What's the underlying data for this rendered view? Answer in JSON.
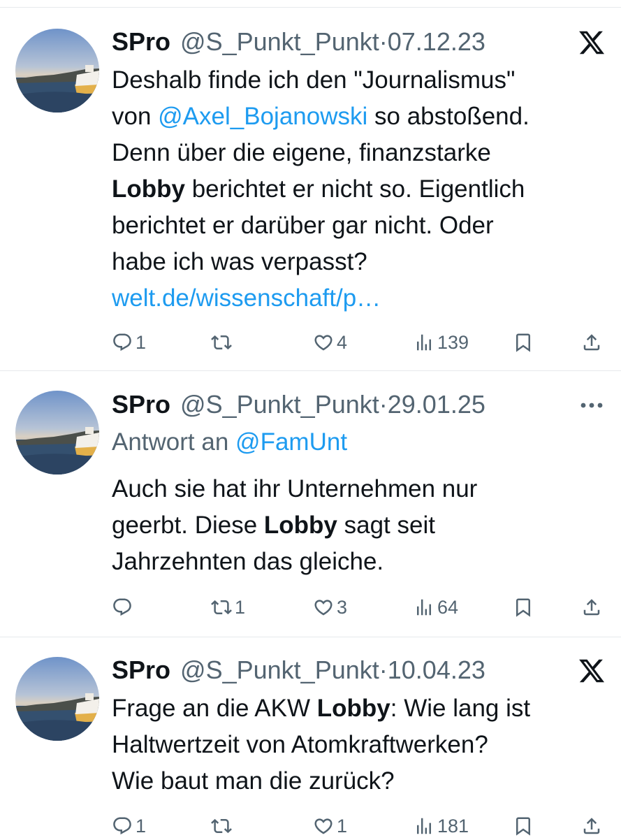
{
  "tweets": [
    {
      "name": "SPro",
      "handle": "@S_Punkt_Punkt",
      "date": "07.12.23",
      "corner_icon": "x-logo-icon",
      "text_a": "Deshalb finde ich den \"Journalismus\"",
      "text_b1": "von ",
      "mention": "@Axel_Bojanowski",
      "text_b2": " so abstoßend.",
      "text_c": "Denn über die eigene, finanzstarke",
      "bold1": "Lobby",
      "text_d": " berichtet er nicht so. Eigentlich",
      "text_e": "berichtet er darüber gar nicht. Oder",
      "text_f": "habe ich was verpasst?",
      "link": "welt.de/wissenschaft/p…",
      "replies": "1",
      "reposts": "",
      "likes": "4",
      "views": "139"
    },
    {
      "name": "SPro",
      "handle": "@S_Punkt_Punkt",
      "date": "29.01.25",
      "corner_icon": "more-options-icon",
      "reply_prefix": "Antwort an ",
      "reply_to": "@FamUnt",
      "text_a": "Auch sie hat ihr Unternehmen nur",
      "text_b1": "geerbt. Diese ",
      "bold1": "Lobby",
      "text_b2": " sagt seit",
      "text_c": "Jahrzehnten das gleiche.",
      "replies": "",
      "reposts": "1",
      "likes": "3",
      "views": "64"
    },
    {
      "name": "SPro",
      "handle": "@S_Punkt_Punkt",
      "date": "10.04.23",
      "corner_icon": "x-logo-icon",
      "text_a1": "Frage an die AKW ",
      "bold1": "Lobby",
      "text_a2": ": Wie lang ist",
      "text_b": "Haltwertzeit von Atomkraftwerken?",
      "text_c": "Wie baut man die zurück?",
      "replies": "1",
      "reposts": "",
      "likes": "1",
      "views": "181"
    }
  ],
  "separator": " · ",
  "colors": {
    "link": "#1d9bf0",
    "muted": "#536471",
    "text": "#0f1419"
  }
}
